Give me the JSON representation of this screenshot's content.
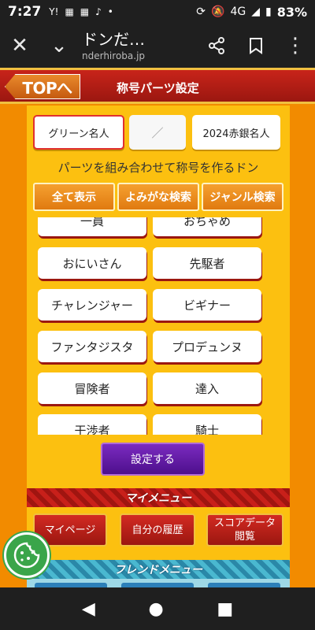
{
  "status_bar": {
    "time": "7:27",
    "left_icons": [
      "Y!",
      "▦",
      "▦",
      "♪",
      "•"
    ],
    "network": "4G",
    "battery": "83%"
  },
  "browser": {
    "title": "ドンだ…",
    "url": "nderhiroba.jp"
  },
  "header": {
    "top_button": "TOPへ",
    "title": "称号パーツ設定"
  },
  "parts": {
    "first": "グリーン名人",
    "middle": "／",
    "last": "2024赤銀名人"
  },
  "instruction": "パーツを組み合わせて称号を作るドン",
  "tabs": [
    "全て表示",
    "よみがな検索",
    "ジャンル検索"
  ],
  "choices": [
    "一員",
    "おちゃめ",
    "おにいさん",
    "先駆者",
    "チャレンジャー",
    "ビギナー",
    "ファンタジスタ",
    "プロデュンヌ",
    "冒険者",
    "達入",
    "干渉者",
    "騎士"
  ],
  "set_button": "設定する",
  "my_menu": {
    "banner": "マイメニュー",
    "buttons": [
      "マイページ",
      "自分の履歴",
      "スコアデータ閲覧"
    ]
  },
  "friend_menu": {
    "banner": "フレンドメニュー"
  },
  "colors": {
    "page_bg": "#f28b00",
    "panel_bg": "#fcc010",
    "header_red": "#c8241a",
    "set_purple": "#6a1fb0"
  }
}
